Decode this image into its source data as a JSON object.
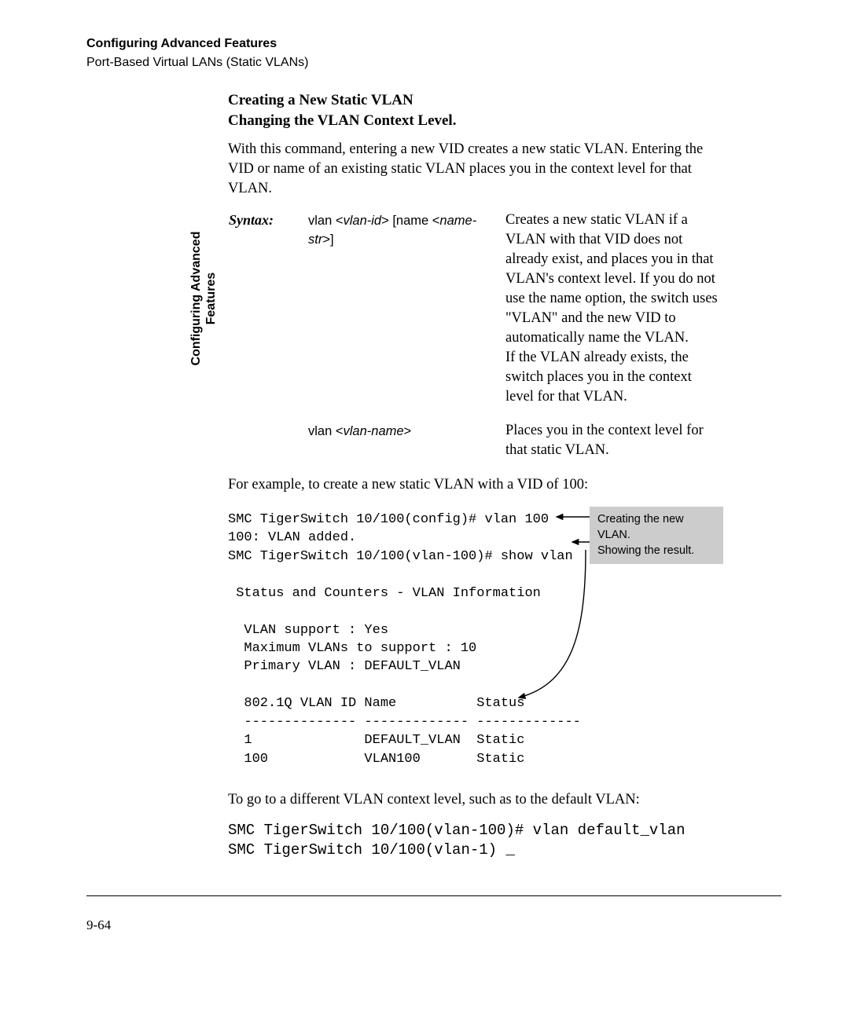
{
  "header": {
    "chapter": "Configuring Advanced Features",
    "section": "Port-Based Virtual LANs (Static VLANs)"
  },
  "side_tab": "Configuring Advanced Features",
  "body": {
    "h1_line1": "Creating a New Static VLAN",
    "h1_line2": "Changing the VLAN Context Level.",
    "intro": "With this command, entering a new VID creates a new static VLAN. Entering the VID or name of an existing static VLAN places you in the context level for that VLAN.",
    "syntax_label": "Syntax:",
    "row1": {
      "cmd_plain1": "vlan <",
      "cmd_ital1": "vlan-id",
      "cmd_plain2": "> [name <",
      "cmd_ital2": "name-str",
      "cmd_plain3": ">]",
      "desc": "Creates a new static VLAN if a VLAN with that VID does not already exist, and places you in that VLAN's context level. If you do not use the name option, the switch uses \"VLAN\" and the new VID to automatically name the VLAN.\nIf the VLAN already exists, the switch places you in the context level for that VLAN."
    },
    "row2": {
      "cmd_plain1": "vlan <",
      "cmd_ital1": "vlan-name",
      "cmd_plain2": ">",
      "desc": "Places you in the context level for that static VLAN."
    },
    "example_lead": "For example, to create a new static VLAN with a VID of 100:",
    "code1": "SMC TigerSwitch 10/100(config)# vlan 100\n100: VLAN added.\nSMC TigerSwitch 10/100(vlan-100)# show vlan\n\n Status and Counters - VLAN Information\n\n  VLAN support : Yes\n  Maximum VLANs to support : 10\n  Primary VLAN : DEFAULT_VLAN\n\n  802.1Q VLAN ID Name          Status\n  -------------- ------------- -------------\n  1              DEFAULT_VLAN  Static\n  100            VLAN100       Static",
    "callout1": "Creating the new VLAN.",
    "callout2": "Showing the result.",
    "para2": "To go to a different VLAN context level, such as to the default VLAN:",
    "code2": "SMC TigerSwitch 10/100(vlan-100)# vlan default_vlan\nSMC TigerSwitch 10/100(vlan-1) _"
  },
  "page_number": "9-64"
}
